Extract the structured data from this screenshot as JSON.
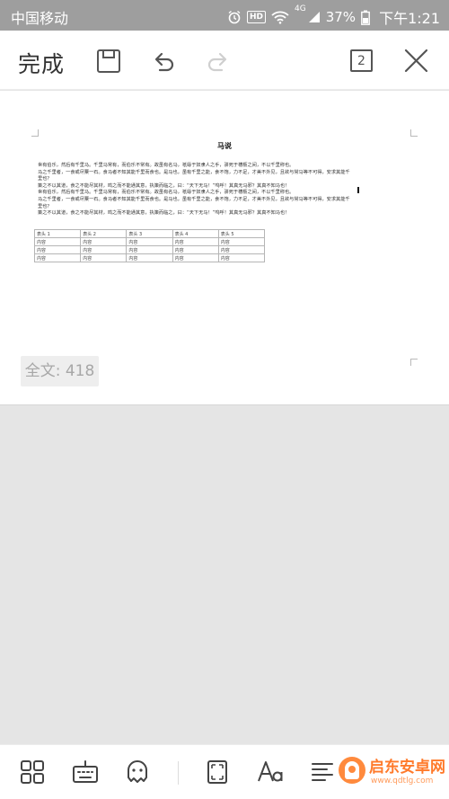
{
  "status_bar": {
    "carrier": "中国移动",
    "hd": "HD",
    "network": "4G",
    "battery": "37%",
    "time": "下午1:21"
  },
  "toolbar": {
    "done_label": "完成",
    "page_count": "2"
  },
  "document": {
    "title": "马说",
    "paragraphs": [
      "世有伯乐，然后有千里马。千里马常有，而伯乐不常有。故虽有名马，祇辱于奴隶人之手，骈死于槽枥之间，不以千里称也。",
      "马之千里者，一食或尽粟一石。食马者不知其能千里而食也。是马也，虽有千里之能，食不饱，力不足，才美不外见，且欲与常马等不可得，安求其能千里也？",
      "策之不以其道，食之不能尽其材，鸣之而不能通其意，执策而临之，曰：“天下无马！”呜呼！其真无马邪？其真不知马也！",
      "世有伯乐，然后有千里马。千里马常有，而伯乐不常有。故虽有名马，祇辱于奴隶人之手，骈死于槽枥之间，不以千里称也。",
      "马之千里者，一食或尽粟一石。食马者不知其能千里而食也。是马也，虽有千里之能，食不饱，力不足，才美不外见，且欲与常马等不可得，安求其能千里也？",
      "策之不以其道，食之不能尽其材，鸣之而不能通其意，执策而临之，曰：“天下无马！”呜呼！其真无马邪？其真不知马也！"
    ],
    "table": {
      "headers": [
        "表头 1",
        "表头 2",
        "表头 3",
        "表头 4",
        "表头 5"
      ],
      "rows": [
        [
          "内容",
          "内容",
          "内容",
          "内容",
          "内容"
        ],
        [
          "内容",
          "内容",
          "内容",
          "内容",
          "内容"
        ],
        [
          "内容",
          "内容",
          "内容",
          "内容",
          "内容"
        ]
      ]
    },
    "word_count": "全文: 418"
  },
  "watermark": {
    "brand": "启东安卓网",
    "url": "www.qdtlg.com"
  },
  "colors": {
    "status_bar": "#9e9e9e",
    "toolbar_icon": "#555555",
    "watermark": "#ff7a2b"
  }
}
